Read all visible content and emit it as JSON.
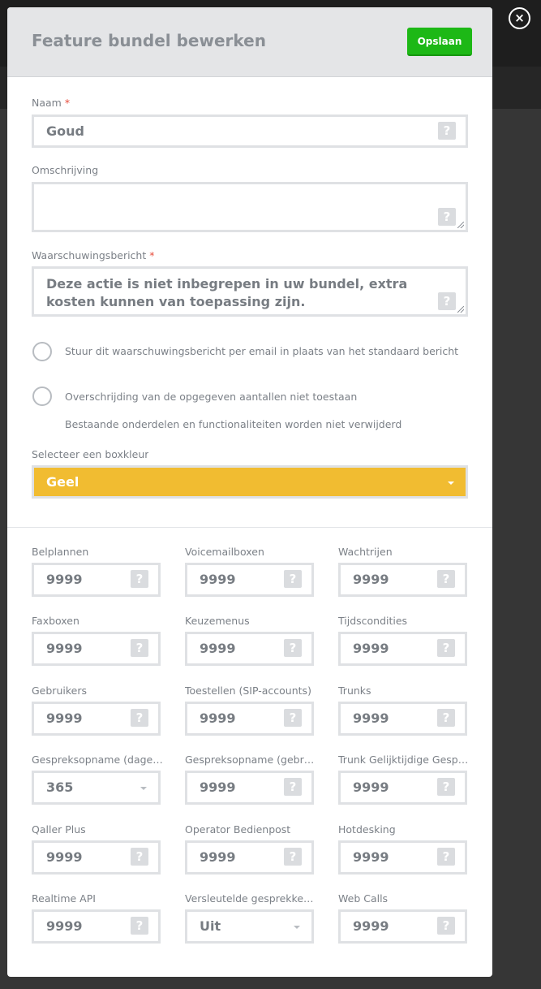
{
  "modal": {
    "title": "Feature bundel bewerken",
    "save_label": "Opslaan",
    "close_label": "×"
  },
  "form": {
    "name": {
      "label": "Naam",
      "required_mark": "*",
      "value": "Goud"
    },
    "description": {
      "label": "Omschrijving",
      "value": ""
    },
    "warning": {
      "label": "Waarschuwingsbericht",
      "required_mark": "*",
      "value": "Deze actie is niet inbegrepen in uw bundel, extra kosten kunnen van toepassing zijn."
    },
    "option_email": {
      "label": "Stuur dit waarschuwingsbericht per email in plaats van het standaard bericht"
    },
    "option_limit": {
      "label": "Overschrijding van de opgegeven aantallen niet toestaan",
      "note": "Bestaande onderdelen en functionaliteiten worden niet verwijderd"
    },
    "box_color": {
      "label": "Selecteer een boxkleur",
      "value": "Geel",
      "color": "#f1bc31"
    },
    "help_glyph": "?"
  },
  "limits": [
    {
      "label": "Belplannen",
      "value": "9999",
      "type": "number"
    },
    {
      "label": "Voicemailboxen",
      "value": "9999",
      "type": "number"
    },
    {
      "label": "Wachtrijen",
      "value": "9999",
      "type": "number"
    },
    {
      "label": "Faxboxen",
      "value": "9999",
      "type": "number"
    },
    {
      "label": "Keuzemenus",
      "value": "9999",
      "type": "number"
    },
    {
      "label": "Tijdscondities",
      "value": "9999",
      "type": "number"
    },
    {
      "label": "Gebruikers",
      "value": "9999",
      "type": "number"
    },
    {
      "label": "Toestellen (SIP-accounts)",
      "value": "9999",
      "type": "number"
    },
    {
      "label": "Trunks",
      "value": "9999",
      "type": "number"
    },
    {
      "label": "Gespreksopname (dage…",
      "value": "365",
      "type": "select"
    },
    {
      "label": "Gespreksopname (gebr…",
      "value": "9999",
      "type": "number"
    },
    {
      "label": "Trunk Gelijktijdige Gespr…",
      "value": "9999",
      "type": "number"
    },
    {
      "label": "Qaller Plus",
      "value": "9999",
      "type": "number"
    },
    {
      "label": "Operator Bedienpost",
      "value": "9999",
      "type": "number"
    },
    {
      "label": "Hotdesking",
      "value": "9999",
      "type": "number"
    },
    {
      "label": "Realtime API",
      "value": "9999",
      "type": "number"
    },
    {
      "label": "Versleutelde gesprekken…",
      "value": "Uit",
      "type": "select"
    },
    {
      "label": "Web Calls",
      "value": "9999",
      "type": "number"
    }
  ]
}
